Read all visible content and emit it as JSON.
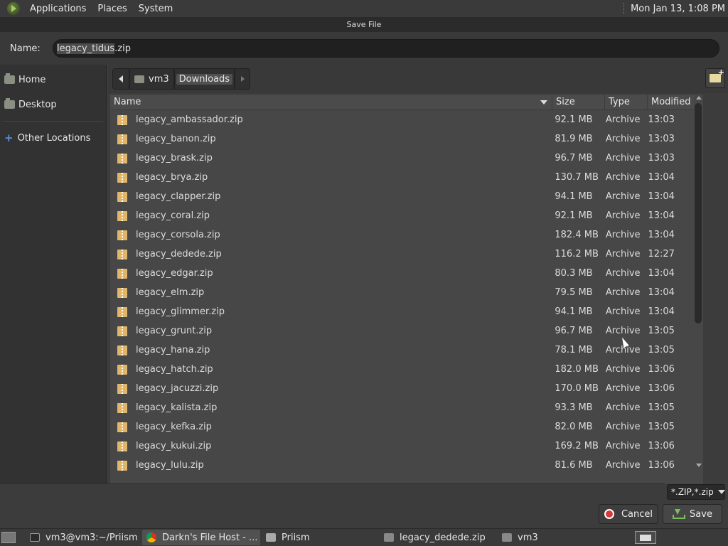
{
  "top_panel": {
    "menus": [
      "Applications",
      "Places",
      "System"
    ],
    "clock": "Mon Jan 13,  1:08 PM"
  },
  "dialog": {
    "title": "Save File",
    "name_label": "Name:",
    "name_value_selected": "legacy_tidus",
    "name_value_rest": ".zip",
    "sidebar": {
      "items": [
        {
          "label": "Home",
          "icon": "home-folder-icon"
        },
        {
          "label": "Desktop",
          "icon": "desktop-folder-icon"
        },
        {
          "label": "Other Locations",
          "icon": "plus-icon"
        }
      ]
    },
    "pathbar": {
      "segments": [
        "vm3",
        "Downloads"
      ]
    },
    "list": {
      "columns": [
        "Name",
        "Size",
        "Type",
        "Modified"
      ],
      "rows": [
        {
          "name": "legacy_ambassador.zip",
          "size": "92.1 MB",
          "type": "Archive",
          "modified": "13:03"
        },
        {
          "name": "legacy_banon.zip",
          "size": "81.9 MB",
          "type": "Archive",
          "modified": "13:03"
        },
        {
          "name": "legacy_brask.zip",
          "size": "96.7 MB",
          "type": "Archive",
          "modified": "13:03"
        },
        {
          "name": "legacy_brya.zip",
          "size": "130.7 MB",
          "type": "Archive",
          "modified": "13:04"
        },
        {
          "name": "legacy_clapper.zip",
          "size": "94.1 MB",
          "type": "Archive",
          "modified": "13:04"
        },
        {
          "name": "legacy_coral.zip",
          "size": "92.1 MB",
          "type": "Archive",
          "modified": "13:04"
        },
        {
          "name": "legacy_corsola.zip",
          "size": "182.4 MB",
          "type": "Archive",
          "modified": "13:04"
        },
        {
          "name": "legacy_dedede.zip",
          "size": "116.2 MB",
          "type": "Archive",
          "modified": "12:27"
        },
        {
          "name": "legacy_edgar.zip",
          "size": "80.3 MB",
          "type": "Archive",
          "modified": "13:04"
        },
        {
          "name": "legacy_elm.zip",
          "size": "79.5 MB",
          "type": "Archive",
          "modified": "13:04"
        },
        {
          "name": "legacy_glimmer.zip",
          "size": "94.1 MB",
          "type": "Archive",
          "modified": "13:04"
        },
        {
          "name": "legacy_grunt.zip",
          "size": "96.7 MB",
          "type": "Archive",
          "modified": "13:05"
        },
        {
          "name": "legacy_hana.zip",
          "size": "78.1 MB",
          "type": "Archive",
          "modified": "13:05"
        },
        {
          "name": "legacy_hatch.zip",
          "size": "182.0 MB",
          "type": "Archive",
          "modified": "13:06"
        },
        {
          "name": "legacy_jacuzzi.zip",
          "size": "170.0 MB",
          "type": "Archive",
          "modified": "13:06"
        },
        {
          "name": "legacy_kalista.zip",
          "size": "93.3 MB",
          "type": "Archive",
          "modified": "13:05"
        },
        {
          "name": "legacy_kefka.zip",
          "size": "82.0 MB",
          "type": "Archive",
          "modified": "13:05"
        },
        {
          "name": "legacy_kukui.zip",
          "size": "169.2 MB",
          "type": "Archive",
          "modified": "13:06"
        },
        {
          "name": "legacy_lulu.zip",
          "size": "81.6 MB",
          "type": "Archive",
          "modified": "13:06"
        }
      ]
    },
    "filter_label": "*.ZIP,*.zip",
    "cancel_label": "Cancel",
    "save_label": "Save"
  },
  "taskbar": {
    "tasks": [
      {
        "label": "vm3@vm3:~/Priism",
        "icon": "terminal-icon",
        "active": false
      },
      {
        "label": "Darkn's File Host - ...",
        "icon": "chrome-icon",
        "active": true
      },
      {
        "label": "Priism",
        "icon": "folder-icon",
        "active": false
      },
      {
        "label": "legacy_dedede.zip",
        "icon": "archive-icon",
        "active": false
      },
      {
        "label": "vm3",
        "icon": "home-folder-icon",
        "active": false
      }
    ]
  }
}
